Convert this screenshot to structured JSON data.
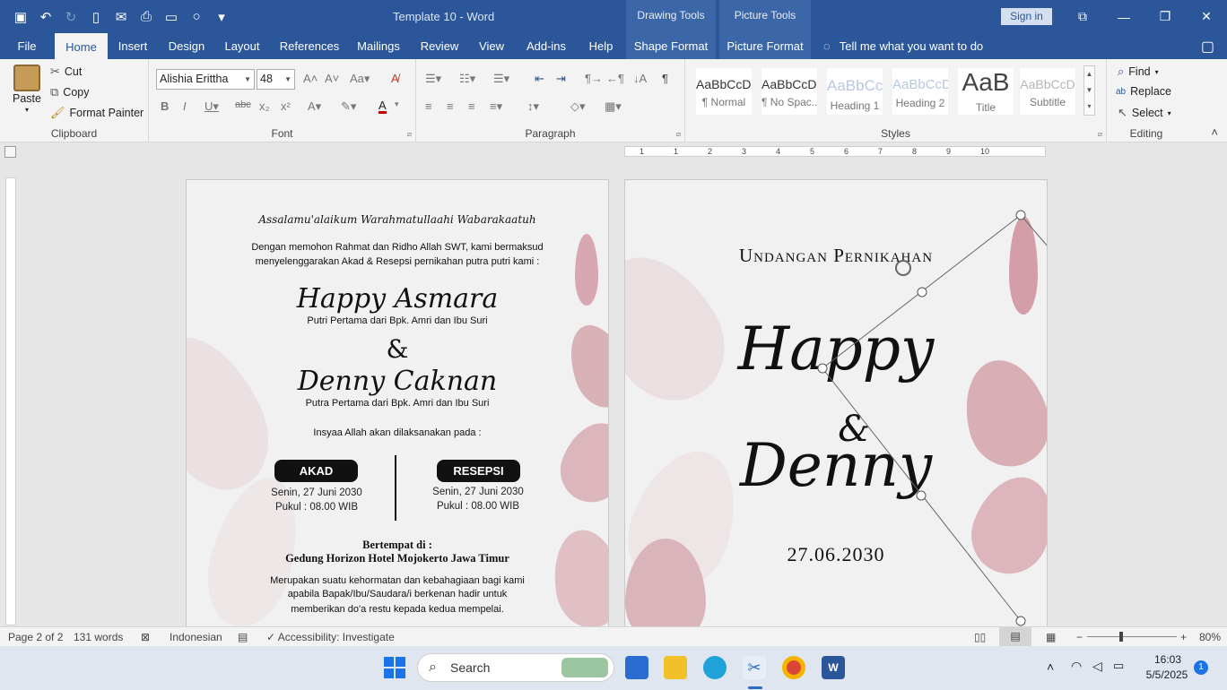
{
  "titlebar": {
    "doc_title": "Template 10  -  Word",
    "drawing_tools": "Drawing Tools",
    "picture_tools": "Picture Tools",
    "sign_in": "Sign in"
  },
  "tabs": {
    "file": "File",
    "home": "Home",
    "insert": "Insert",
    "design": "Design",
    "layout": "Layout",
    "references": "References",
    "mailings": "Mailings",
    "review": "Review",
    "view": "View",
    "addins": "Add-ins",
    "help": "Help",
    "shape_format": "Shape Format",
    "picture_format": "Picture Format",
    "tell_me": "Tell me what you want to do"
  },
  "clipboard": {
    "paste": "Paste",
    "cut": "Cut",
    "copy": "Copy",
    "format_painter": "Format Painter",
    "label": "Clipboard"
  },
  "font": {
    "name": "Alishia Erittha",
    "size": "48",
    "label": "Font"
  },
  "paragraph": {
    "label": "Paragraph"
  },
  "styles": {
    "label": "Styles",
    "items": [
      {
        "preview": "AaBbCcDc",
        "name": "¶ Normal"
      },
      {
        "preview": "AaBbCcDc",
        "name": "¶ No Spac..."
      },
      {
        "preview": "AaBbCc",
        "name": "Heading 1"
      },
      {
        "preview": "AaBbCcD",
        "name": "Heading 2"
      },
      {
        "preview": "AaB",
        "name": "Title"
      },
      {
        "preview": "AaBbCcD",
        "name": "Subtitle"
      }
    ]
  },
  "editing": {
    "find": "Find",
    "replace": "Replace",
    "select": "Select",
    "label": "Editing"
  },
  "ruler": {
    "marks": [
      "1",
      "1",
      "2",
      "3",
      "4",
      "5",
      "6",
      "7",
      "8",
      "9",
      "10"
    ]
  },
  "page1": {
    "greeting": "Assalamu'alaikum Warahmatullaahi Wabarakaatuh",
    "intro_1": "Dengan memohon Rahmat dan Ridho Allah SWT, kami bermaksud",
    "intro_2": "menyelenggarakan Akad & Resepsi pernikahan putra putri kami :",
    "bride": "Happy Asmara",
    "bride_parent": "Putri Pertama dari Bpk. Amri dan Ibu Suri",
    "amp": "&",
    "groom": "Denny Caknan",
    "groom_parent": "Putra Pertama dari Bpk. Amri dan Ibu Suri",
    "insyaallah": "Insyaa Allah akan dilaksanakan pada :",
    "akad": {
      "title": "AKAD",
      "date": "Senin, 27 Juni 2030",
      "time": "Pukul : 08.00 WIB"
    },
    "resepsi": {
      "title": "RESEPSI",
      "date": "Senin, 27 Juni 2030",
      "time": "Pukul : 08.00 WIB"
    },
    "venue_label": "Bertempat di :",
    "venue": "Gedung Horizon Hotel Mojokerto Jawa Timur",
    "closing_1": "Merupakan suatu kehormatan dan kebahagiaan bagi kami",
    "closing_2": "apabila Bapak/Ibu/Saudara/i berkenan hadir untuk",
    "closing_3": "memberikan do'a restu kepada kedua mempelai."
  },
  "page2": {
    "heading": "Undangan Pernikahan",
    "name1": "Happy",
    "amp": "&",
    "name2": "Denny",
    "date": "27.06.2030"
  },
  "status": {
    "page": "Page 2 of 2",
    "words": "131 words",
    "language": "Indonesian",
    "accessibility": "Accessibility: Investigate",
    "zoom": "80%"
  },
  "taskbar": {
    "search": "Search",
    "time": "16:03",
    "date": "5/5/2025",
    "badge": "1"
  }
}
